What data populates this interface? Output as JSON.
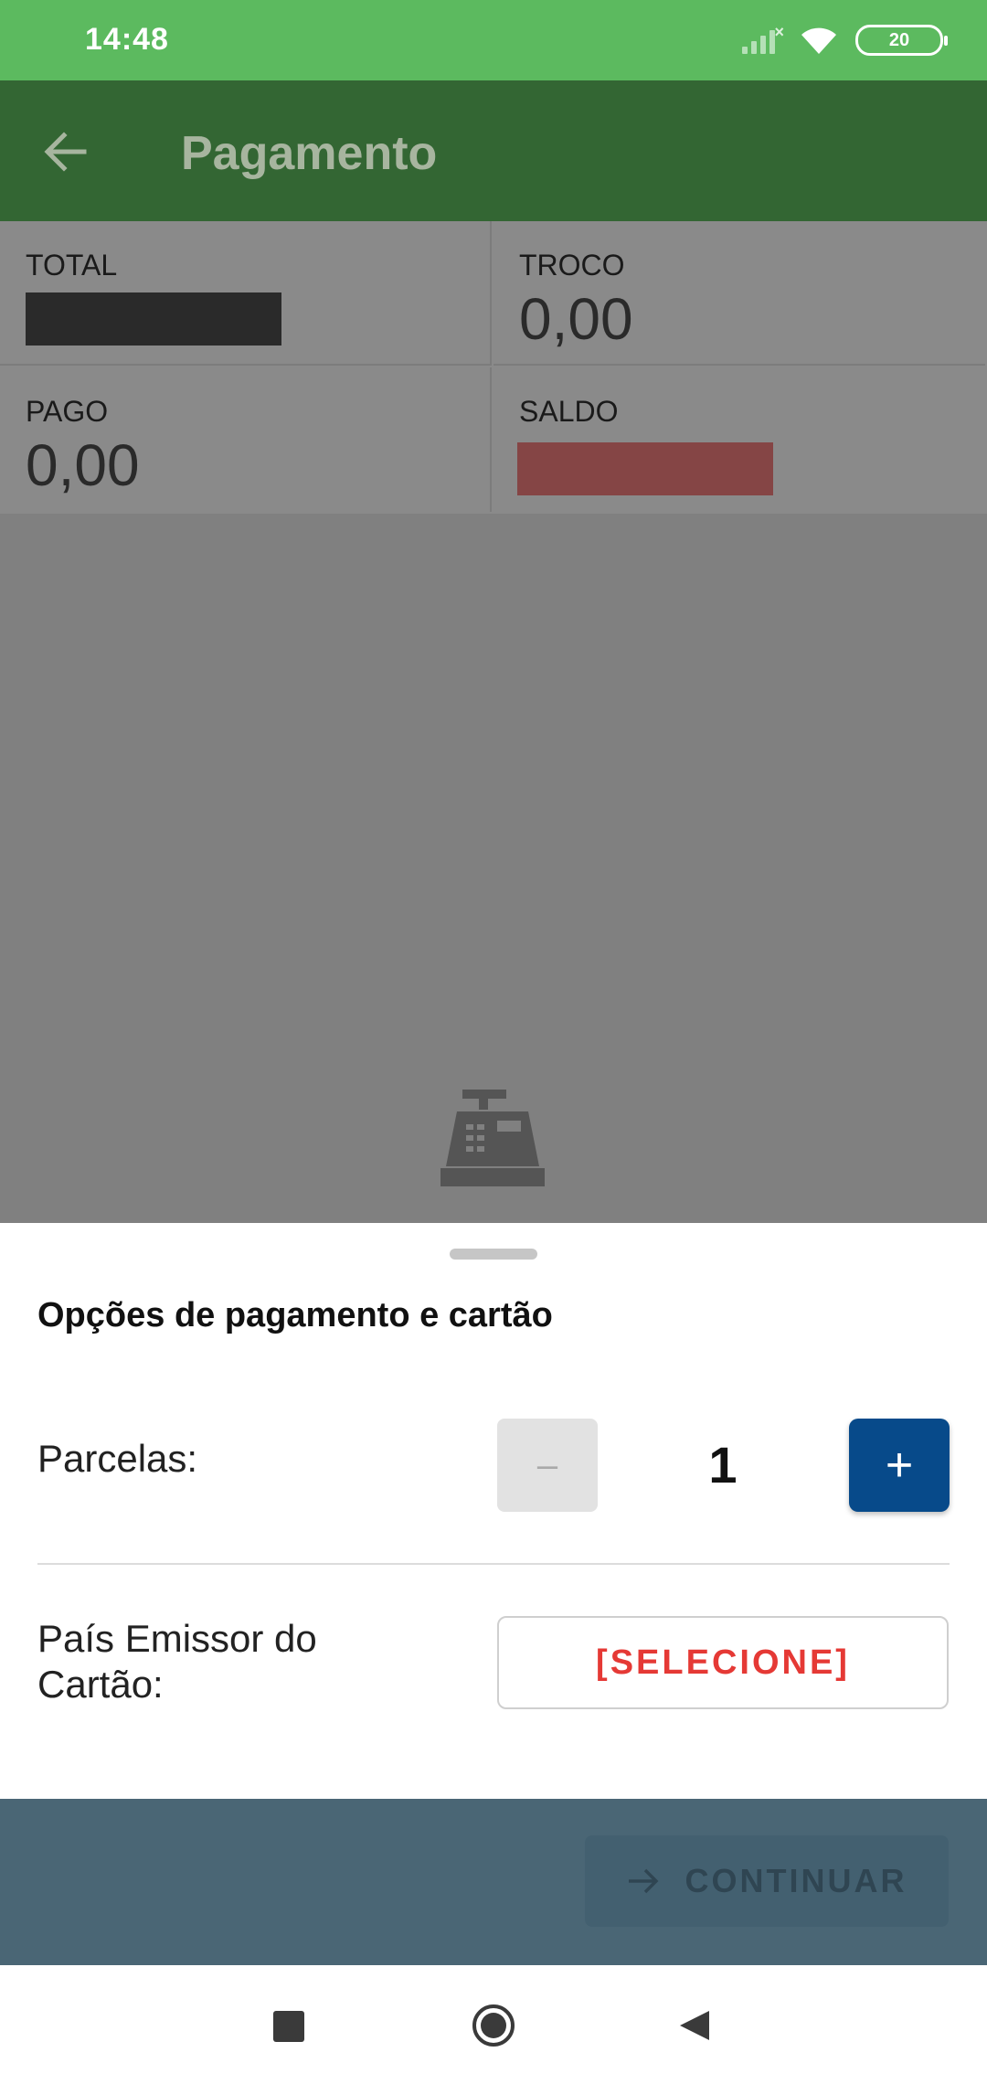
{
  "status_bar": {
    "time": "14:48",
    "battery": "20"
  },
  "app_bar": {
    "title": "Pagamento",
    "back_icon": "arrow-left-icon"
  },
  "summary": {
    "total": {
      "label": "TOTAL",
      "value": ""
    },
    "troco": {
      "label": "TROCO",
      "value": "0,00"
    },
    "pago": {
      "label": "PAGO",
      "value": "0,00"
    },
    "saldo": {
      "label": "SALDO",
      "value": ""
    }
  },
  "background_icon": "cash-register-icon",
  "sheet": {
    "title": "Opções de pagamento e cartão",
    "parcelas": {
      "label": "Parcelas:",
      "minus": "–",
      "plus": "+",
      "value": "1"
    },
    "pais": {
      "label": "País Emissor do Cartão:",
      "select_value": "[SELECIONE]"
    }
  },
  "footer": {
    "continue_label": "CONTINUAR",
    "continue_icon": "arrow-right-icon"
  },
  "nav": {
    "recents_icon": "square-icon",
    "home_icon": "circle-icon",
    "back_icon": "triangle-back-icon"
  },
  "colors": {
    "status_bar": "#5cba5f",
    "app_bar": "#336633",
    "plus_button": "#074a8a",
    "select_text": "#e53935",
    "footer": "#4a6675"
  }
}
